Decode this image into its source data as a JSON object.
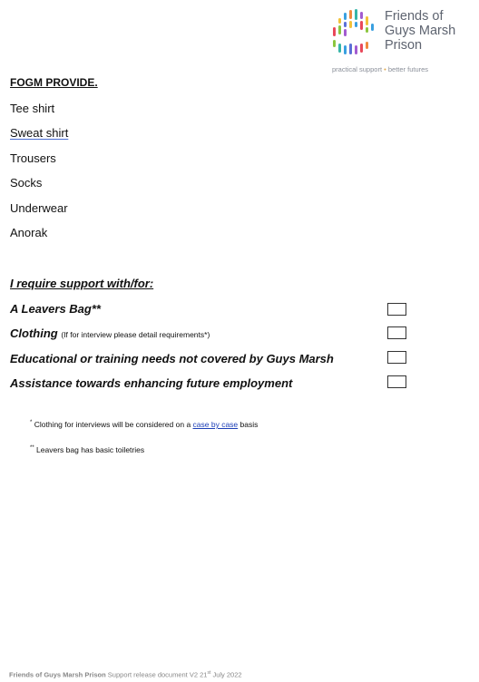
{
  "logo": {
    "line1": "Friends of",
    "line2": "Guys Marsh",
    "line3": "Prison",
    "tagline_left": "practical support",
    "tagline_sep": "•",
    "tagline_right": "better futures",
    "dot_colors": [
      "#e9485a",
      "#f08a3c",
      "#f2c23a",
      "#8cc63f",
      "#35b5a8",
      "#3aa0e0",
      "#5b6fd6",
      "#a25bd0"
    ]
  },
  "provide": {
    "heading": "FOGM PROVIDE.",
    "items": [
      "Tee shirt",
      "Sweat shirt",
      "Trousers",
      "Socks",
      "Underwear",
      "Anorak"
    ]
  },
  "require": {
    "heading": "I require support with/for:",
    "items": [
      {
        "label": "A Leavers Bag**",
        "note": ""
      },
      {
        "label": "Clothing",
        "note": "(If for interview please detail requirements*)"
      },
      {
        "label": "Educational or training needs not covered by Guys Marsh",
        "note": ""
      },
      {
        "label": "Assistance towards enhancing future employment",
        "note": ""
      }
    ]
  },
  "footnotes": {
    "one_mark": "*",
    "one_text_pre": "Clothing for interviews will be considered on a",
    "one_link": "case by case",
    "one_text_post": "basis",
    "two_mark": "**",
    "two_text": "Leavers bag has basic toiletries"
  },
  "footer": {
    "org": "Friends of Guys Marsh Prison",
    "doc": "Support release document V2 21",
    "sup": "st",
    "date": "July 2022"
  }
}
